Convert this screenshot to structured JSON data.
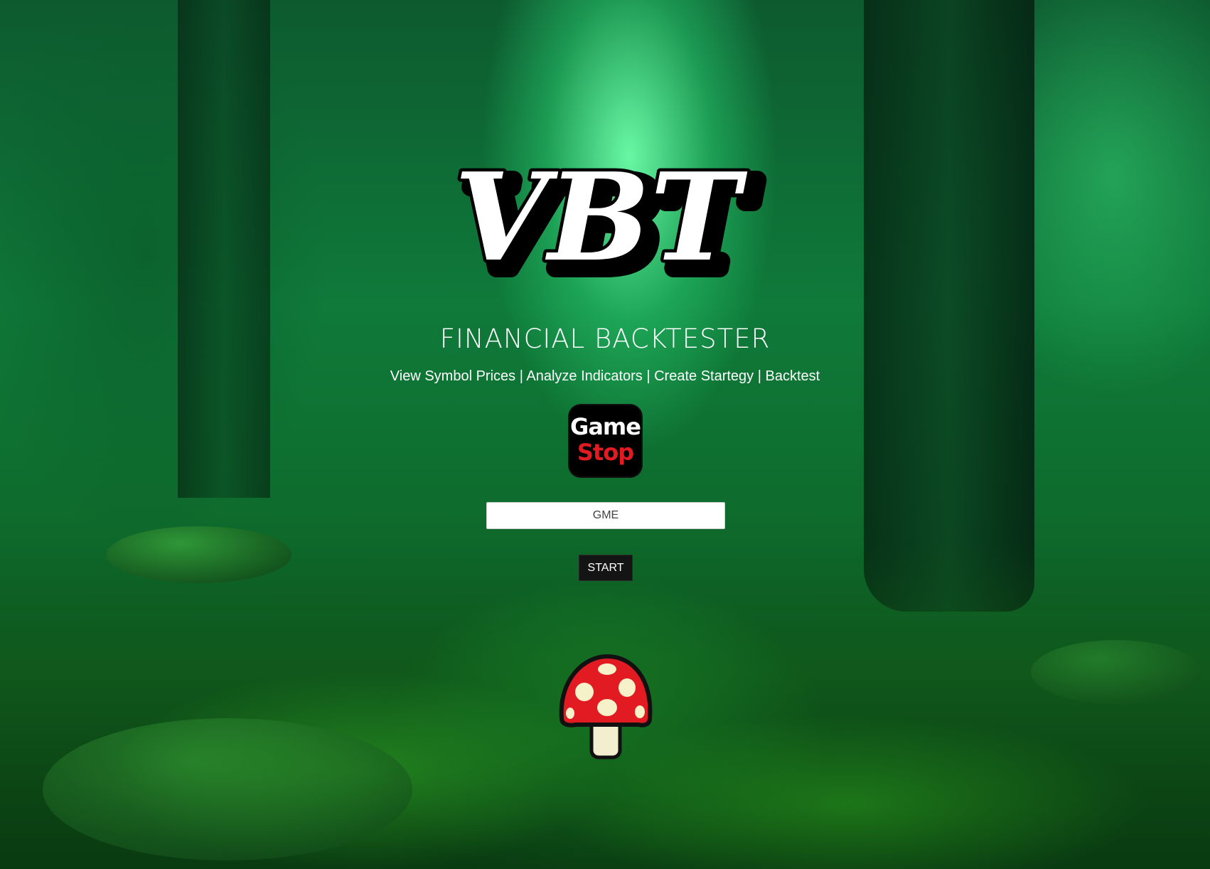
{
  "brand": {
    "logo_text": "VBT",
    "subtitle": "FINANCIAL BACKTESTER"
  },
  "nav": {
    "items": [
      "View Symbol Prices",
      "Analyze Indicators",
      "Create Startegy",
      "Backtest"
    ],
    "separator": " | "
  },
  "symbol_logo": {
    "line1": "Game",
    "line2": "Stop"
  },
  "symbol_input": {
    "value": "GME",
    "placeholder": "GME"
  },
  "start_button": {
    "label": "START"
  },
  "decorations": {
    "mushroom_icon": "mushroom-icon"
  },
  "colors": {
    "accent_red": "#e21b23",
    "button_bg": "#141414",
    "text": "#ffffff"
  }
}
